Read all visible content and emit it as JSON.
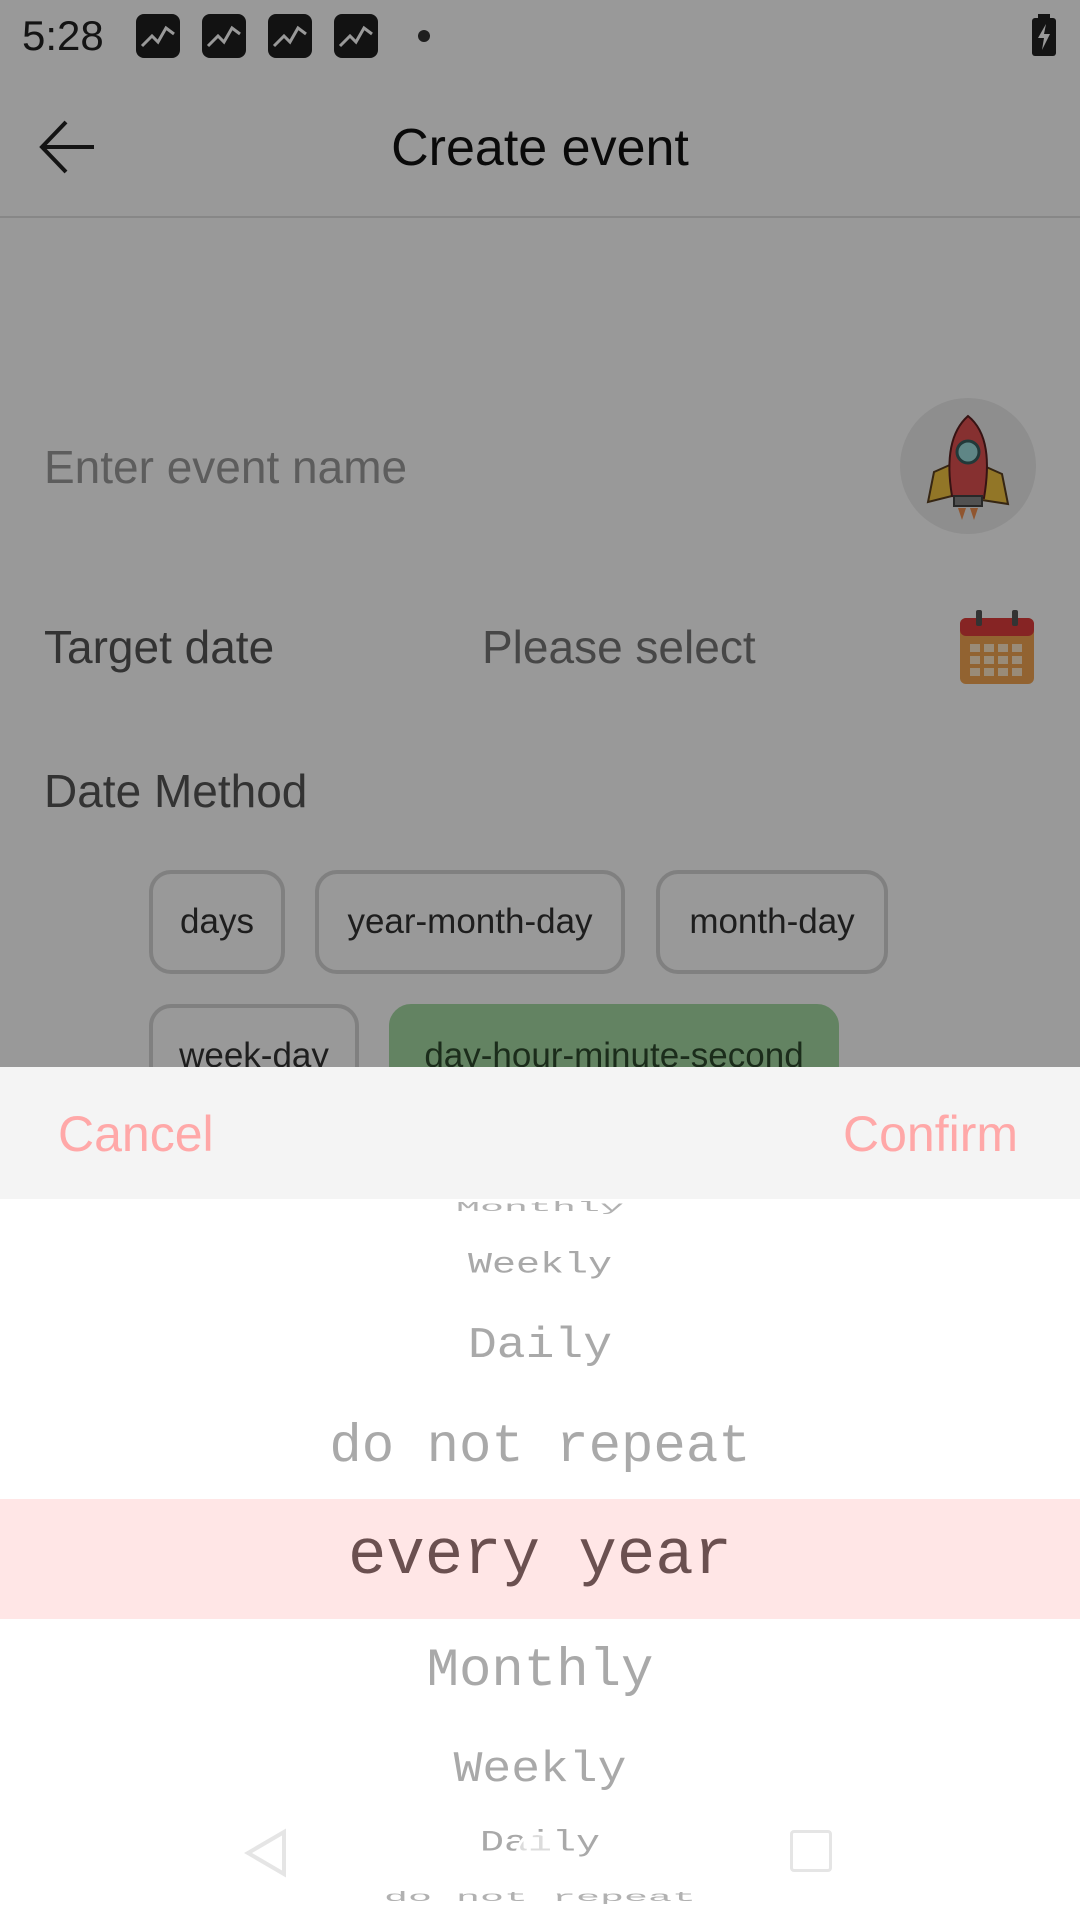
{
  "status_bar": {
    "time": "5:28",
    "notification_icons": [
      "app-notification-icon",
      "app-notification-icon",
      "app-notification-icon",
      "app-notification-icon"
    ],
    "battery_icon": "battery-charging-icon"
  },
  "app_bar": {
    "title": "Create event",
    "back_icon": "arrow-left-icon"
  },
  "form": {
    "event_name_placeholder": "Enter event name",
    "avatar_icon": "rocket-icon",
    "target_date_label": "Target date",
    "target_date_value": "Please select",
    "calendar_icon": "calendar-icon",
    "date_method_label": "Date Method",
    "date_methods": [
      {
        "label": "days",
        "selected": false
      },
      {
        "label": "year-month-day",
        "selected": false
      },
      {
        "label": "month-day",
        "selected": false
      },
      {
        "label": "week-day",
        "selected": false
      },
      {
        "label": "day-hour-minute-second",
        "selected": true
      }
    ]
  },
  "repeat_picker": {
    "cancel_label": "Cancel",
    "confirm_label": "Confirm",
    "items_visible": [
      "Monthly",
      "Weekly",
      "Daily",
      "do not repeat",
      "every year",
      "Monthly",
      "Weekly",
      "Daily",
      "do not repeat"
    ],
    "selected_value": "every year",
    "colors": {
      "accent": "#ffa8a8",
      "highlight": "#ffe6e6",
      "selected_text": "#6b5050",
      "chip_selected": "#a6dba3"
    }
  }
}
